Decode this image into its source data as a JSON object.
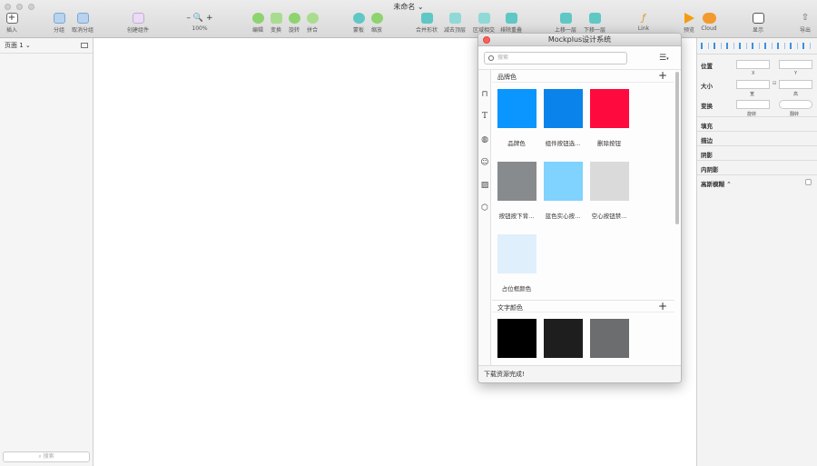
{
  "window": {
    "title": "未命名"
  },
  "toolbar": {
    "items": [
      {
        "label": "插入"
      },
      {
        "label": "分组"
      },
      {
        "label": "取消分组"
      },
      {
        "label": "创建组件"
      },
      {
        "label": "100%"
      },
      {
        "label": "编辑"
      },
      {
        "label": "变换"
      },
      {
        "label": "旋转"
      },
      {
        "label": "拼合"
      },
      {
        "label": "蒙板"
      },
      {
        "label": "缩放"
      },
      {
        "label": "合并形状"
      },
      {
        "label": "减去顶层"
      },
      {
        "label": "区域相交"
      },
      {
        "label": "排除重叠"
      },
      {
        "label": "上移一层"
      },
      {
        "label": "下移一层"
      },
      {
        "label": "Link"
      },
      {
        "label": "预览"
      },
      {
        "label": "Cloud"
      },
      {
        "label": "显示"
      },
      {
        "label": "导出"
      }
    ],
    "zoom_minus": "–",
    "zoom_plus": "+"
  },
  "sidebar": {
    "page_label": "页面 1 ⌄",
    "search_placeholder": "搜索"
  },
  "inspector": {
    "position_label": "位置",
    "x_label": "X",
    "y_label": "Y",
    "size_label": "大小",
    "width_label": "宽",
    "height_label": "高",
    "transform_label": "变换",
    "rotate_label": "旋转",
    "flip_label": "翻转",
    "sections": [
      "填充",
      "描边",
      "阴影",
      "内阴影",
      "高斯模糊 ⌃"
    ]
  },
  "design_system": {
    "title": "Mockplus设计系统",
    "search_placeholder": "搜索",
    "sections": [
      {
        "title": "品牌色",
        "swatches": [
          {
            "name": "品牌色",
            "color": "#0a95ff"
          },
          {
            "name": "组件按钮选...",
            "color": "#0a84ea"
          },
          {
            "name": "删除按钮",
            "color": "#ff0a3e"
          },
          {
            "name": "按钮按下背...",
            "color": "#888b8e"
          },
          {
            "name": "蓝色实心按...",
            "color": "#80d2ff"
          },
          {
            "name": "空心按钮禁...",
            "color": "#dadada"
          },
          {
            "name": "占位框颜色",
            "color": "#e0effc"
          }
        ]
      },
      {
        "title": "文字颜色",
        "swatches": [
          {
            "name": "",
            "color": "#000000"
          },
          {
            "name": "",
            "color": "#1e1e1e"
          },
          {
            "name": "",
            "color": "#6b6d6f"
          }
        ]
      }
    ],
    "status": "下载资源完成!"
  }
}
